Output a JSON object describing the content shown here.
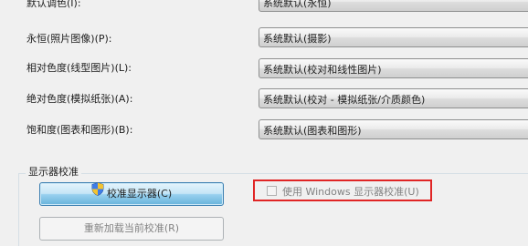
{
  "rendering": [
    {
      "label": "默认调色(I):",
      "value": "系统默认(永恒)"
    },
    {
      "label": "永恒(照片图像)(P):",
      "value": "系统默认(摄影)"
    },
    {
      "label": "相对色度(线型图片)(L):",
      "value": "系统默认(校对和线性图片)"
    },
    {
      "label": "绝对色度(模拟纸张)(A):",
      "value": "系统默认(校对 - 模拟纸张/介质颜色)"
    },
    {
      "label": "饱和度(图表和图形)(B):",
      "value": "系统默认(图表和图形)"
    }
  ],
  "calibration": {
    "group_title": "显示器校准",
    "calibrate_button": "校准显示器(C)",
    "reload_button": "重新加载当前校准(R)",
    "use_windows_checkbox": {
      "label": "使用 Windows 显示器校准(U)",
      "checked": false,
      "enabled": false
    }
  }
}
